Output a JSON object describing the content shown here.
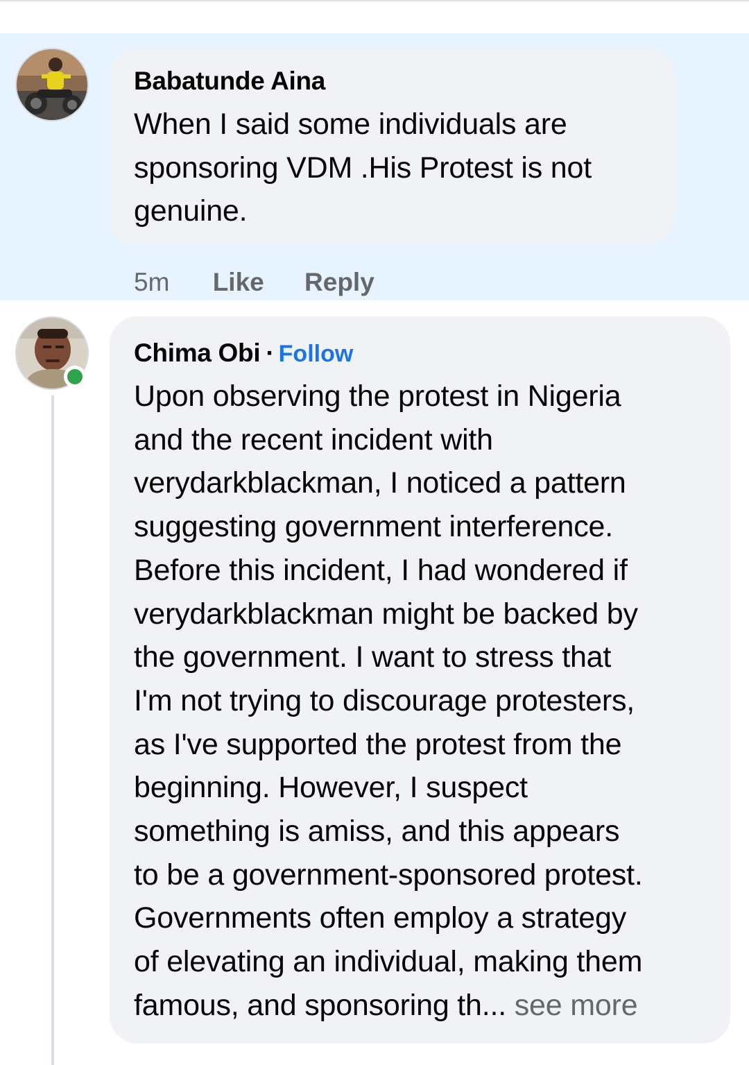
{
  "comments": [
    {
      "author": "Babatunde Aina",
      "avatar_icon": "profile-photo-motorcycle",
      "lines": [
        "When I said some individuals are",
        "sponsoring VDM .His Protest is not",
        "genuine."
      ],
      "time": "5m",
      "like_label": "Like",
      "reply_label": "Reply",
      "highlighted": true
    },
    {
      "author": "Chima Obi",
      "separator": "·",
      "follow_label": "Follow",
      "avatar_icon": "profile-photo-man",
      "online": true,
      "lines": [
        "Upon observing the protest in Nigeria",
        "and the recent incident with",
        "verydarkblackman, I noticed a pattern",
        "suggesting government interference.",
        "Before this incident, I had wondered if",
        "verydarkblackman might be backed by",
        "the government. I want to stress that",
        "I'm not trying to discourage protesters,",
        "as I've supported the protest from the",
        "beginning. However, I suspect",
        "something is amiss, and this appears",
        "to be a government-sponsored protest.",
        "Governments often employ a strategy",
        "of elevating an individual, making them"
      ],
      "last_line_prefix": "famous, and sponsoring th",
      "ellipsis": "...",
      "see_more_label": " see more"
    }
  ],
  "colors": {
    "highlight_bg": "#e7f3ff",
    "bubble_bg": "#f0f2f5",
    "follow_blue": "#1b74e4",
    "online_green": "#31a24c",
    "secondary_text": "#65676b"
  }
}
